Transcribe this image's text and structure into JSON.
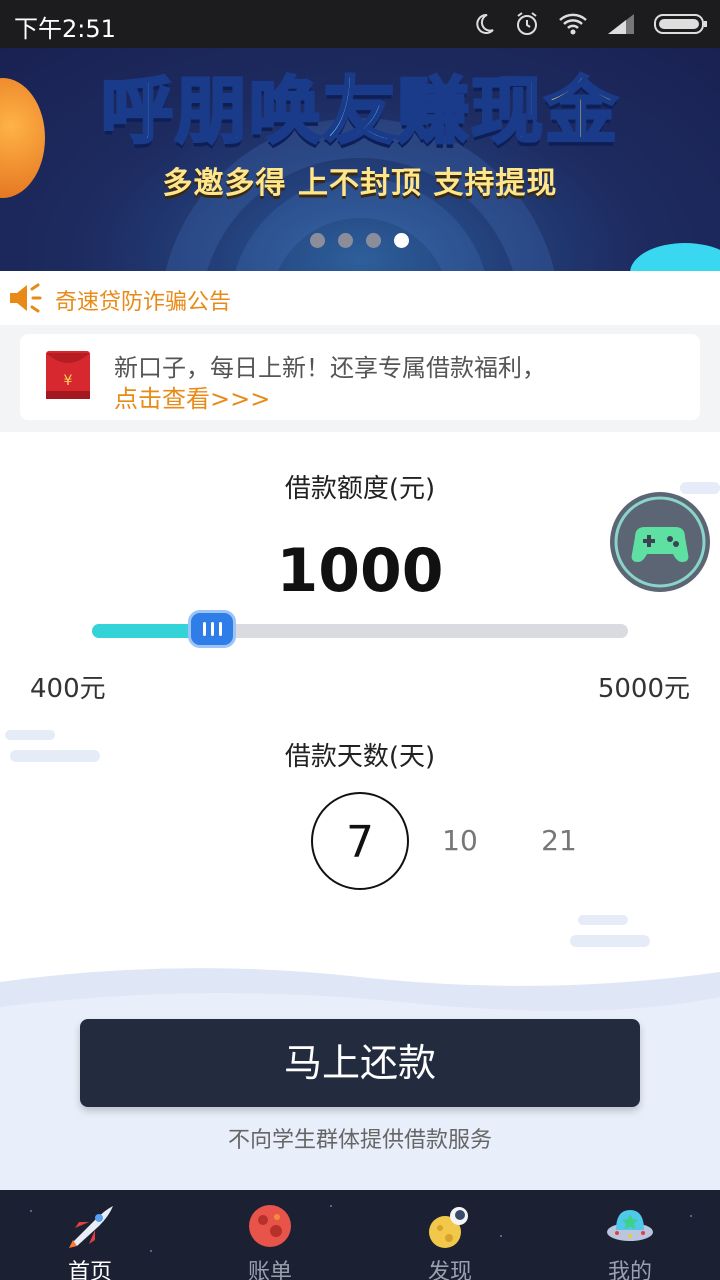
{
  "status_bar": {
    "time": "下午2:51",
    "icons": [
      "moon-icon",
      "alarm-icon",
      "wifi-icon",
      "signal-icon",
      "battery-icon"
    ]
  },
  "banner": {
    "title_main": "呼朋唤友赚",
    "title_highlight": "现金",
    "subtitle": "多邀多得  上不封顶  支持提现",
    "slide_count": 4,
    "active_slide": 4
  },
  "notice": {
    "icon": "speaker-icon",
    "text": "奇速贷防诈骗公告"
  },
  "promo": {
    "icon": "red-envelope-icon",
    "line1": "新口子，每日上新！还享专属借款福利，",
    "line2": "点击查看>>>"
  },
  "loan": {
    "amount_label": "借款额度(元)",
    "amount_value": "1000",
    "amount_min": 400,
    "amount_max": 5000,
    "amount_current": 1000,
    "min_label": "400元",
    "max_label": "5000元",
    "days_label": "借款天数(天)",
    "day_options": [
      "7",
      "10",
      "21"
    ],
    "selected_day": "7"
  },
  "floating": {
    "icon": "gamepad-icon"
  },
  "actions": {
    "repay_label": "马上还款",
    "disclaimer": "不向学生群体提供借款服务"
  },
  "tabbar": {
    "items": [
      {
        "label": "首页",
        "icon": "rocket-icon",
        "active": true
      },
      {
        "label": "账单",
        "icon": "planet-icon",
        "active": false
      },
      {
        "label": "发现",
        "icon": "astronaut-moon-icon",
        "active": false
      },
      {
        "label": "我的",
        "icon": "ufo-icon",
        "active": false
      }
    ]
  },
  "colors": {
    "accent_orange": "#e88a18",
    "slider_fill": "#34d3d8",
    "slider_thumb": "#2f7de8",
    "button_dark": "#232b3e",
    "tabbar_bg": "#1b2133"
  }
}
